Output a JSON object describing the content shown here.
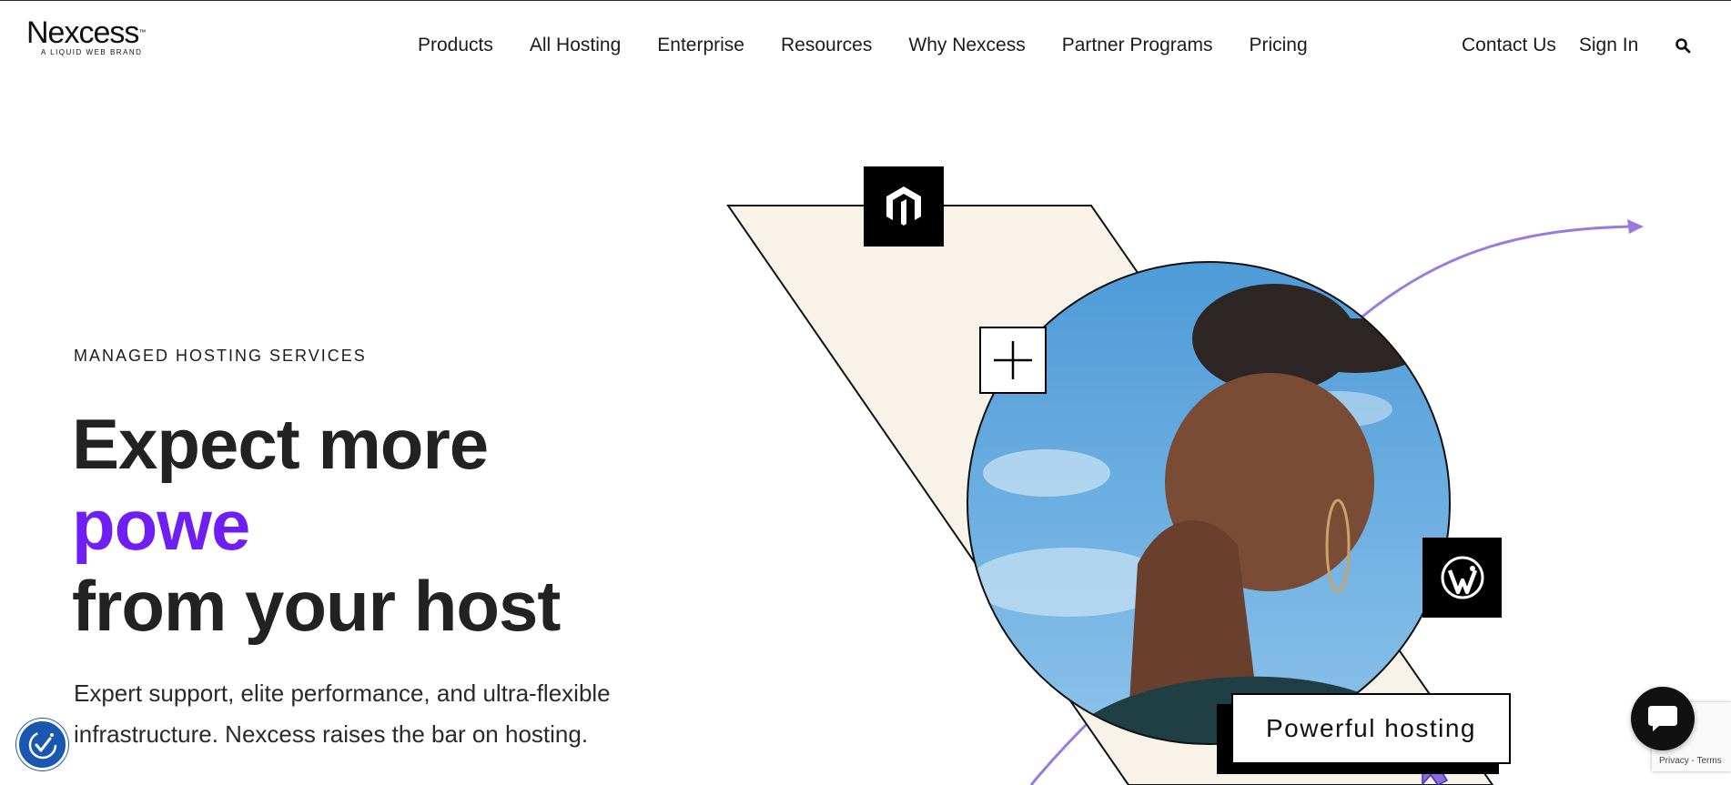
{
  "header": {
    "logo": {
      "wordmark": "Nexcess",
      "trademark": "™",
      "tagline": "A LIQUID WEB BRAND"
    },
    "nav": [
      {
        "label": "Products"
      },
      {
        "label": "All Hosting"
      },
      {
        "label": "Enterprise"
      },
      {
        "label": "Resources"
      },
      {
        "label": "Why Nexcess"
      },
      {
        "label": "Partner Programs"
      },
      {
        "label": "Pricing"
      }
    ],
    "utility": {
      "contact_label": "Contact Us",
      "signin_label": "Sign In"
    },
    "icons": {
      "search": "search-icon"
    }
  },
  "hero": {
    "eyebrow": "MANAGED HOSTING SERVICES",
    "headline": {
      "line1": "Expect more",
      "accent": "powe",
      "line3": "from your host"
    },
    "subcopy": "Expert support, elite performance, and ultra-flexible infrastructure. Nexcess raises the bar on hosting.",
    "badge_label": "Powerful hosting",
    "icons": [
      "magento-icon",
      "plus-icon",
      "wordpress-icon",
      "cursor-icon",
      "arrow-icon"
    ]
  },
  "widgets": {
    "accessibility_icon": "accessibility-icon",
    "chat_icon": "chat-icon",
    "recaptcha": {
      "links": "Privacy - Terms"
    }
  },
  "colors": {
    "accent_purple": "#6f1ff4",
    "arrow_purple": "#9b7ae0",
    "cream": "#f8f2e8",
    "sky_blue": "#5fa8df",
    "accessibility_blue": "#1a57b0",
    "text": "#1c1c1c"
  }
}
